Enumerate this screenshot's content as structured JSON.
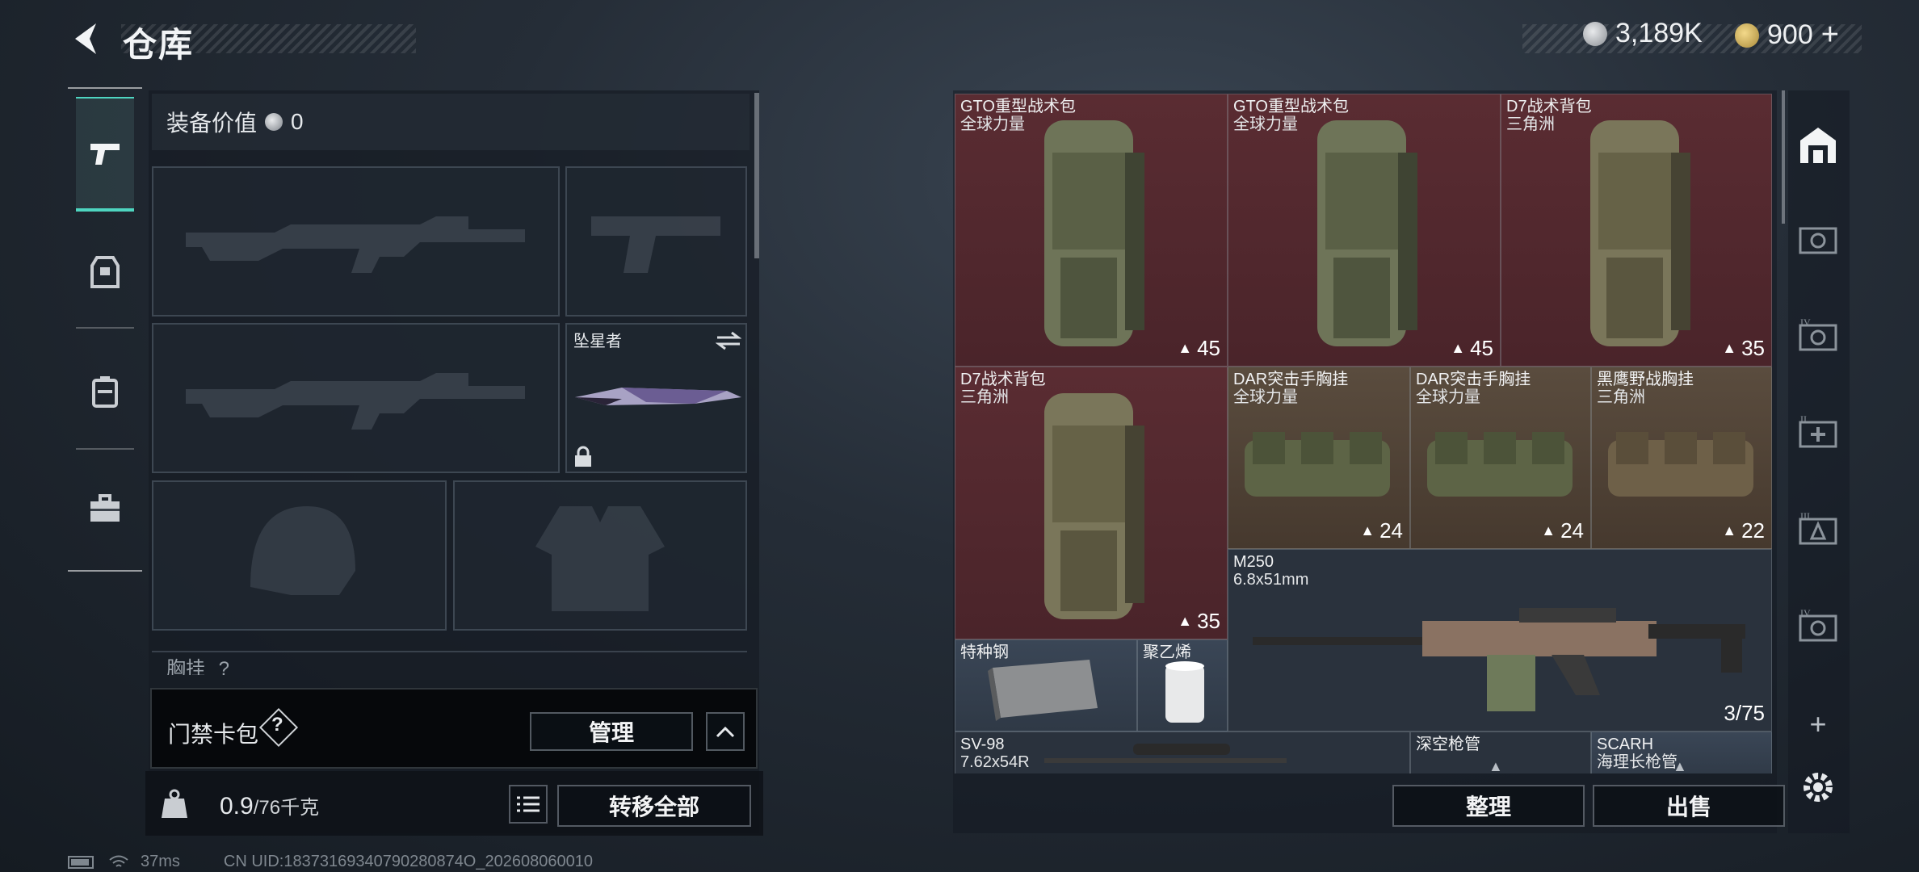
{
  "header": {
    "title": "仓库",
    "currency_silver": "3,189K",
    "currency_gold": "900"
  },
  "equipment": {
    "value_label": "装备价值",
    "value": "0",
    "melee_name": "坠星者",
    "chest_rig_label": "胸挂",
    "chest_rig_count": "?"
  },
  "keycard": {
    "label": "门禁卡包",
    "help": "?",
    "manage_button": "管理"
  },
  "footer": {
    "weight_current": "0.9",
    "weight_max": "/76千克",
    "transfer_all_button": "转移全部"
  },
  "grid": {
    "items": [
      {
        "name": "GTO重型战术包",
        "sub": "全球力量",
        "count": "45",
        "color": "red"
      },
      {
        "name": "GTO重型战术包",
        "sub": "全球力量",
        "count": "45",
        "color": "red"
      },
      {
        "name": "D7战术背包",
        "sub": "三角洲",
        "count": "35",
        "color": "red"
      },
      {
        "name": "D7战术背包",
        "sub": "三角洲",
        "count": "35",
        "color": "red"
      },
      {
        "name": "DAR突击手胸挂",
        "sub": "全球力量",
        "count": "24",
        "color": "brown"
      },
      {
        "name": "DAR突击手胸挂",
        "sub": "全球力量",
        "count": "24",
        "color": "brown"
      },
      {
        "name": "黑鹰野战胸挂",
        "sub": "三角洲",
        "count": "22",
        "color": "brown"
      },
      {
        "name": "M250",
        "sub": "6.8x51mm",
        "count": "3/75",
        "color": "dark"
      },
      {
        "name": "特种钢",
        "sub": "",
        "count": "",
        "color": "blue"
      },
      {
        "name": "聚乙烯",
        "sub": "",
        "count": "",
        "color": "blue"
      },
      {
        "name": "SV-98",
        "sub": "7.62x54R",
        "count": "",
        "color": "dark"
      },
      {
        "name": "深空枪管",
        "sub": "",
        "count": "",
        "color": "dark"
      },
      {
        "name": "SCARH",
        "sub": "海理长枪管",
        "count": "",
        "color": "blue"
      }
    ]
  },
  "actions": {
    "sort_button": "整理",
    "sell_button": "出售"
  },
  "status": {
    "ping": "37ms",
    "uid": "CN UID:18373169340790280874O_202608060010"
  },
  "colors": {
    "accent": "#4ed5c0",
    "red_rarity": "#5a2c32",
    "brown_rarity": "#5a4c3e"
  }
}
